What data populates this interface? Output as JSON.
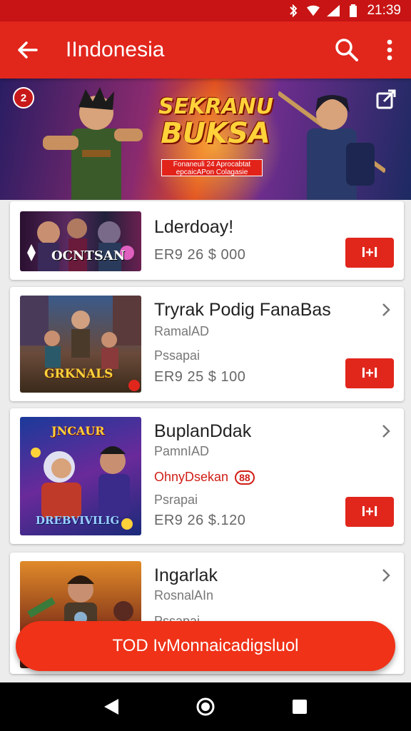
{
  "status_bar": {
    "time": "21:39"
  },
  "app_bar": {
    "title": "IIndonesia"
  },
  "banner": {
    "title_line1": "SEKRANU",
    "title_line2": "BUKSA",
    "tagline": "Fonaneuli 24 Aprocabtat epcaicAPon Colagasie",
    "badge": "2"
  },
  "items": [
    {
      "name": "Lderdoay!",
      "price": "ER9   26 $ 000",
      "buy_label": "I+I",
      "thumb_label": "OCNTSAN"
    },
    {
      "name": "Tryrak Podig FanaBas",
      "subtitle": "RamalAD",
      "detail": "Pssapai",
      "price": "ER9   25 $ 100",
      "buy_label": "I+I",
      "thumb_label": "GRKNALS"
    },
    {
      "name": "BuplanDdak",
      "subtitle": "PamnIAD",
      "promo": "OhnyDsekan",
      "promo_badge": "88",
      "detail": "Psrapai",
      "price": "ER9   26 $.120",
      "buy_label": "I+I",
      "thumb_label": "DREBVIVILIG",
      "thumb_top_label": "JNCAUR"
    },
    {
      "name": "Ingarlak",
      "subtitle": "RosnalAIn",
      "detail": "Pssapai"
    }
  ],
  "cta": {
    "label": "TOD IvMonnaicadigsluol"
  },
  "colors": {
    "primary": "#e1261c",
    "status": "#c81414",
    "cta": "#ef3218"
  }
}
